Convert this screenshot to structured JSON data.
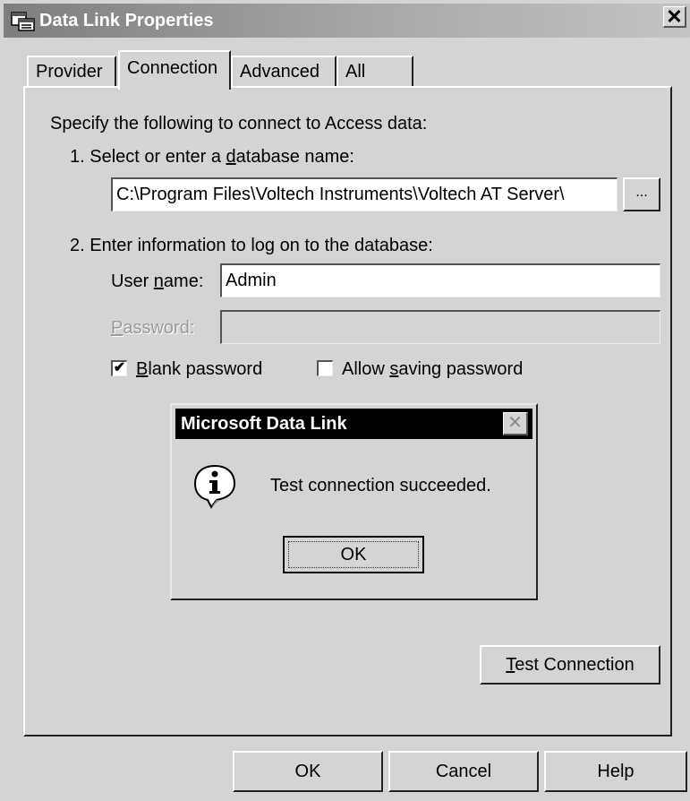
{
  "window": {
    "title": "Data Link Properties",
    "close_glyph": "✕"
  },
  "tabs": [
    {
      "label": "Provider"
    },
    {
      "label": "Connection",
      "selected": true
    },
    {
      "label": "Advanced"
    },
    {
      "label": "All"
    }
  ],
  "connection": {
    "intro": "Specify the following to connect to Access data:",
    "step1_prefix": "1. Select or enter a ",
    "step1_mnemonic": "d",
    "step1_suffix": "atabase name:",
    "database_value": "C:\\Program Files\\Voltech Instruments\\Voltech AT Server\\",
    "browse_label": "...",
    "step2": "2. Enter information to log on to the database:",
    "user_prefix": "User ",
    "user_mnemonic": "n",
    "user_suffix": "ame:",
    "user_value": "Admin",
    "password_mnemonic": "P",
    "password_suffix": "assword:",
    "password_value": "",
    "blank_pw_mnemonic": "B",
    "blank_pw_suffix": "lank password",
    "blank_pw_checked": true,
    "allow_prefix": "Allow ",
    "allow_mnemonic": "s",
    "allow_suffix": "aving password",
    "allow_checked": false,
    "test_mnemonic": "T",
    "test_suffix": "est Connection"
  },
  "message_box": {
    "title": "Microsoft Data Link",
    "close_glyph": "✕",
    "text": "Test connection succeeded.",
    "ok_label": "OK",
    "icon": "info-icon"
  },
  "footer": {
    "ok_label": "OK",
    "cancel_label": "Cancel",
    "help_label": "Help"
  },
  "colors": {
    "face": "#d4d4d4",
    "title_start": "#7e7e7e",
    "title_end": "#c4c4c4",
    "msg_title": "#000000"
  }
}
